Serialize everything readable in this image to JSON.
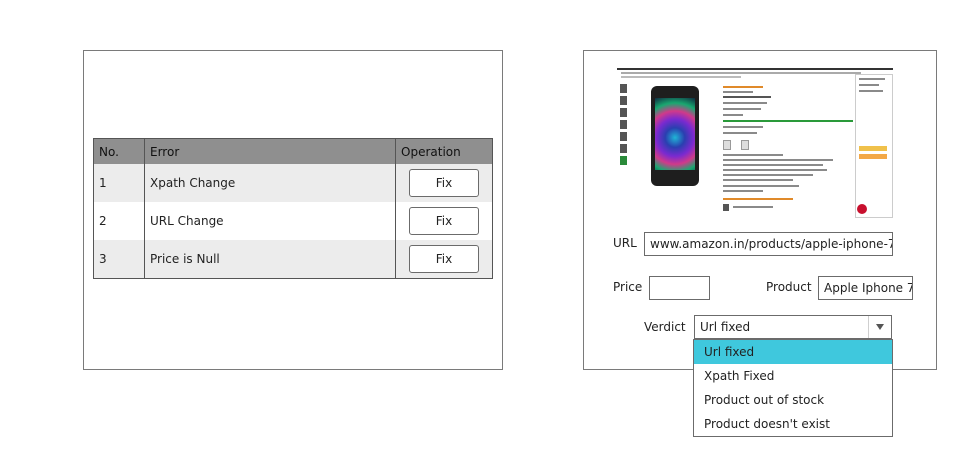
{
  "errors_table": {
    "headers": [
      "No.",
      "Error",
      "Operation"
    ],
    "rows": [
      {
        "no": "1",
        "error": "Xpath Change",
        "action": "Fix"
      },
      {
        "no": "2",
        "error": "URL Change",
        "action": "Fix"
      },
      {
        "no": "3",
        "error": "Price is Null",
        "action": "Fix"
      }
    ]
  },
  "detail": {
    "url_label": "URL",
    "url_value": "www.amazon.in/products/apple-iphone-7",
    "price_label": "Price",
    "price_value": "",
    "product_label": "Product",
    "product_value": "Apple Iphone 7",
    "verdict_label": "Verdict",
    "verdict_value": "Url fixed",
    "verdict_options": [
      "Url fixed",
      "Xpath Fixed",
      "Product out of stock",
      "Product doesn't exist"
    ],
    "selected_option_color": "#3fc8dd"
  }
}
